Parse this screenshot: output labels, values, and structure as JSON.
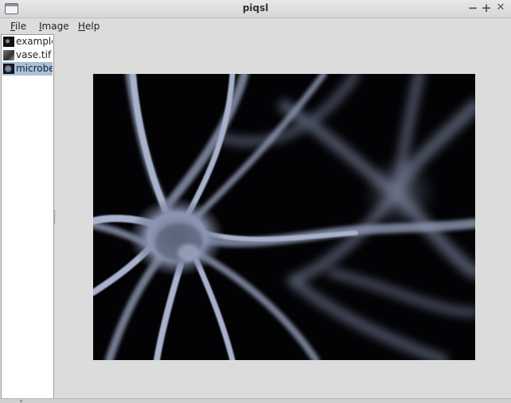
{
  "window": {
    "title": "piqsl"
  },
  "window_controls": {
    "minimize": "−",
    "maximize": "+",
    "close": "✕"
  },
  "menu": [
    {
      "label": "File",
      "mnemonic": "F",
      "rest": "ile"
    },
    {
      "label": "Image",
      "mnemonic": "I",
      "rest": "mage"
    },
    {
      "label": "Help",
      "mnemonic": "H",
      "rest": "elp"
    }
  ],
  "files": [
    {
      "label": "example.t",
      "selected": false,
      "icon": "image-thumbnail-icon"
    },
    {
      "label": "vase.tif",
      "selected": false,
      "icon": "image-thumbnail-icon"
    },
    {
      "label": "microbe.t",
      "selected": true,
      "icon": "image-thumbnail-icon"
    }
  ],
  "colors": {
    "selection": "#a6c1dc",
    "background": "#dcdcdc",
    "image_background": "#030306",
    "neuron_tint": "#aab4d2"
  }
}
